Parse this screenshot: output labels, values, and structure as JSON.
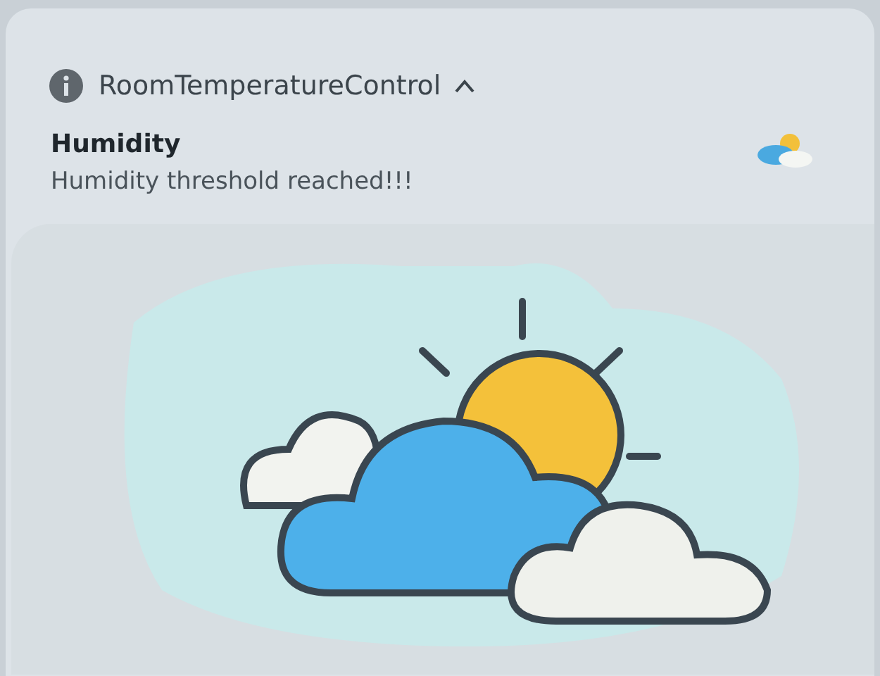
{
  "notification": {
    "app_name": "RoomTemperatureControl",
    "expanded": true,
    "title": "Humidity",
    "message": "Humidity threshold reached!!!"
  }
}
